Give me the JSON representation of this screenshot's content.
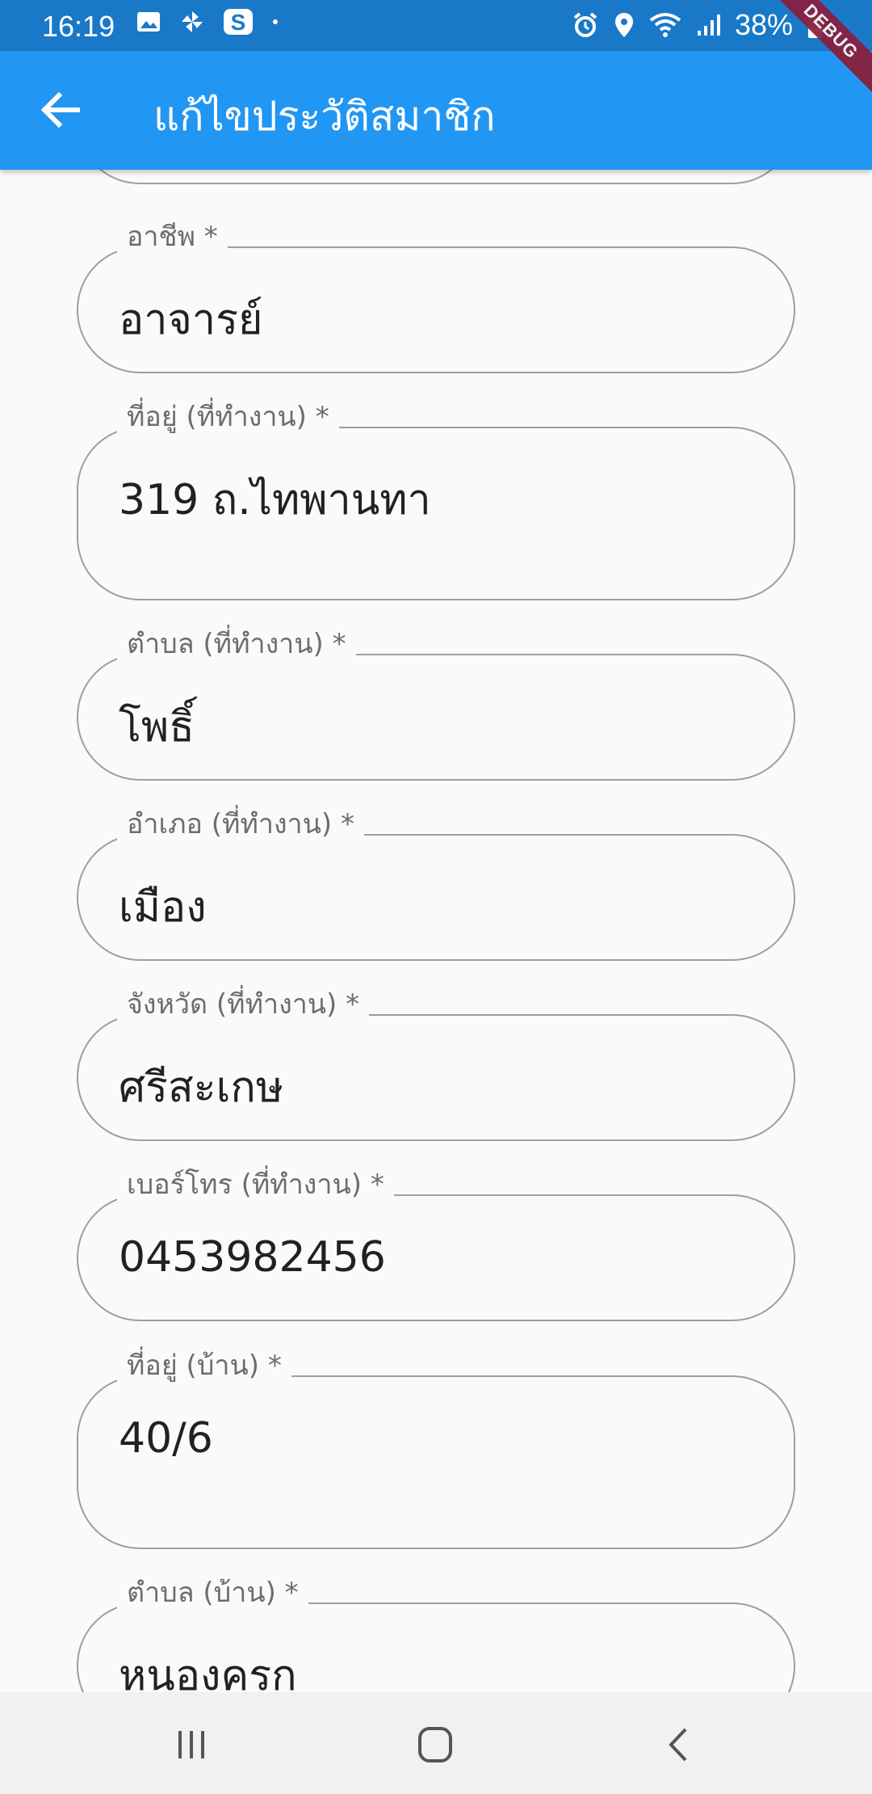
{
  "status_bar": {
    "time": "16:19",
    "battery": "38%",
    "left_icons": [
      "image-icon",
      "pinwheel-icon",
      "s-app-icon",
      "dot-icon"
    ],
    "right_icons": [
      "alarm-icon",
      "location-icon",
      "wifi-icon",
      "signal-icon",
      "battery-icon"
    ]
  },
  "debug_banner": "DEBUG",
  "app_bar": {
    "title": "แก้ไขประวัติสมาชิก",
    "back_icon": "arrow-back-icon"
  },
  "form": {
    "fields": [
      {
        "label": "อาชีพ *",
        "value": "อาจารย์"
      },
      {
        "label": "ที่อยู่ (ที่ทำงาน) *",
        "value": "319 ถ.ไทพานทา"
      },
      {
        "label": "ตำบล (ที่ทำงาน) *",
        "value": "โพธิ์"
      },
      {
        "label": "อำเภอ (ที่ทำงาน) *",
        "value": "เมือง"
      },
      {
        "label": "จังหวัด (ที่ทำงาน) *",
        "value": "ศรีสะเกษ"
      },
      {
        "label": "เบอร์โทร (ที่ทำงาน) *",
        "value": "0453982456"
      },
      {
        "label": "ที่อยู่ (บ้าน) *",
        "value": "40/6"
      },
      {
        "label": "ตำบล (บ้าน) *",
        "value": "หนองครก"
      }
    ]
  },
  "colors": {
    "status_bar": "#1a78c9",
    "app_bar": "#2196f3",
    "background": "#fafafa",
    "outline": "#9e9e9e",
    "label": "#6d6d6d"
  },
  "nav_bar": {
    "buttons": [
      "recent-apps-icon",
      "home-icon",
      "back-icon"
    ]
  }
}
